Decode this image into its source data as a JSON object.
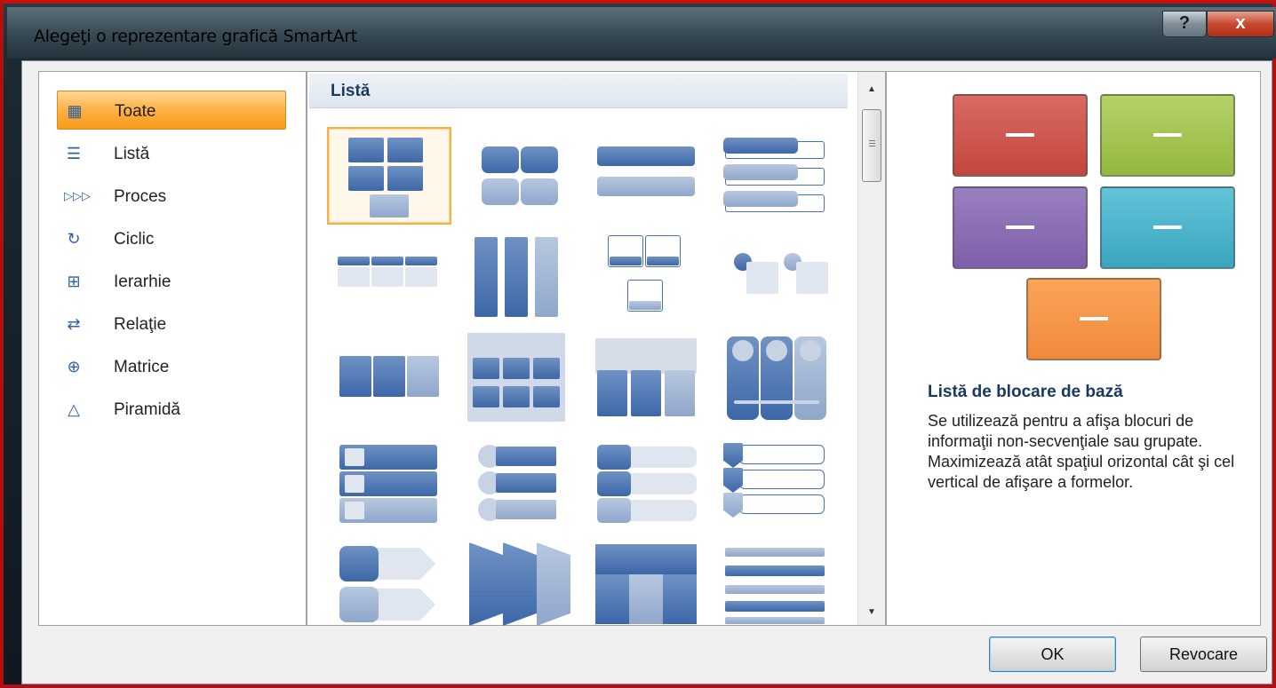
{
  "window": {
    "title": "Alegeţi o reprezentare grafică SmartArt",
    "help_label": "?",
    "close_label": "x"
  },
  "categories": [
    {
      "label": "Toate",
      "icon": "all-icon",
      "selected": true
    },
    {
      "label": "Listă",
      "icon": "list-icon"
    },
    {
      "label": "Proces",
      "icon": "process-icon"
    },
    {
      "label": "Ciclic",
      "icon": "cycle-icon"
    },
    {
      "label": "Ierarhie",
      "icon": "hierarchy-icon"
    },
    {
      "label": "Relaţie",
      "icon": "relationship-icon"
    },
    {
      "label": "Matrice",
      "icon": "matrix-icon"
    },
    {
      "label": "Piramidă",
      "icon": "pyramid-icon"
    }
  ],
  "gallery": {
    "header": "Listă",
    "selected_index": 0
  },
  "preview": {
    "title": "Listă de blocare de bază",
    "description": "Se utilizează pentru a afişa blocuri de informaţii non-secvenţiale sau grupate. Maximizează atât spaţiul orizontal cât şi cel vertical de afişare a formelor.",
    "block_colors": [
      "#c2463d",
      "#93b83d",
      "#7d5fa8",
      "#3aa5bf",
      "#f2893b"
    ]
  },
  "buttons": {
    "ok": "OK",
    "cancel": "Revocare"
  }
}
